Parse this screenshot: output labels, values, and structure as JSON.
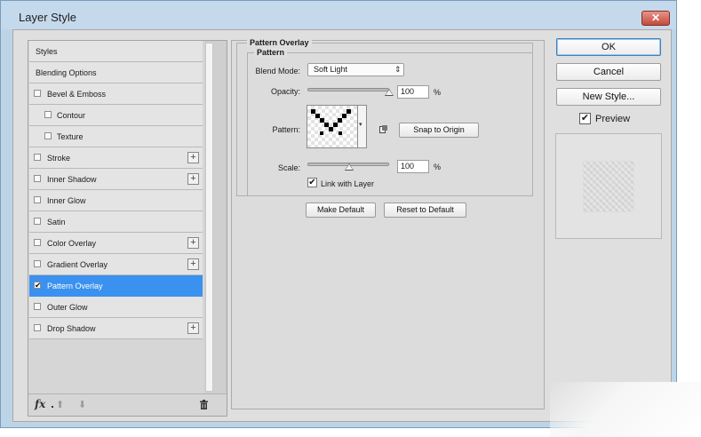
{
  "window": {
    "title": "Layer Style",
    "close_glyph": "✕"
  },
  "style_list": {
    "items": [
      {
        "label": "Styles",
        "checkbox": false,
        "plus": false,
        "checked": false,
        "indent": 0
      },
      {
        "label": "Blending Options",
        "checkbox": false,
        "plus": false,
        "checked": false,
        "indent": 0
      },
      {
        "label": "Bevel & Emboss",
        "checkbox": true,
        "plus": false,
        "checked": false,
        "indent": 0
      },
      {
        "label": "Contour",
        "checkbox": true,
        "plus": false,
        "checked": false,
        "indent": 1
      },
      {
        "label": "Texture",
        "checkbox": true,
        "plus": false,
        "checked": false,
        "indent": 1
      },
      {
        "label": "Stroke",
        "checkbox": true,
        "plus": true,
        "checked": false,
        "indent": 0
      },
      {
        "label": "Inner Shadow",
        "checkbox": true,
        "plus": true,
        "checked": false,
        "indent": 0
      },
      {
        "label": "Inner Glow",
        "checkbox": true,
        "plus": false,
        "checked": false,
        "indent": 0
      },
      {
        "label": "Satin",
        "checkbox": true,
        "plus": false,
        "checked": false,
        "indent": 0
      },
      {
        "label": "Color Overlay",
        "checkbox": true,
        "plus": true,
        "checked": false,
        "indent": 0
      },
      {
        "label": "Gradient Overlay",
        "checkbox": true,
        "plus": true,
        "checked": false,
        "indent": 0
      },
      {
        "label": "Pattern Overlay",
        "checkbox": true,
        "plus": false,
        "checked": true,
        "indent": 0,
        "active": true
      },
      {
        "label": "Outer Glow",
        "checkbox": true,
        "plus": false,
        "checked": false,
        "indent": 0
      },
      {
        "label": "Drop Shadow",
        "checkbox": true,
        "plus": true,
        "checked": false,
        "indent": 0
      }
    ],
    "footer": {
      "fx": "fx",
      "up": "⬆",
      "down": "⬇"
    },
    "active_color": "#3a91f0"
  },
  "pattern_overlay": {
    "group_title": "Pattern Overlay",
    "sub_title": "Pattern",
    "blend_mode_label": "Blend Mode:",
    "blend_mode_value": "Soft Light",
    "blend_mode_arrows": "⇕",
    "opacity_label": "Opacity:",
    "opacity_value": "100",
    "opacity_level": 1.0,
    "pattern_label": "Pattern:",
    "snap_button": "Snap to Origin",
    "scale_label": "Scale:",
    "scale_value": "100",
    "scale_level": 0.5,
    "percent": "%",
    "link_label": "Link with Layer",
    "link_checked": true,
    "make_default": "Make Default",
    "reset_default": "Reset to Default",
    "dropdown_arrow": "▾"
  },
  "actions": {
    "ok": "OK",
    "cancel": "Cancel",
    "new_style": "New Style...",
    "preview_label": "Preview",
    "preview_checked": true
  },
  "glyphs": {
    "check": "✔",
    "plus": "+"
  }
}
